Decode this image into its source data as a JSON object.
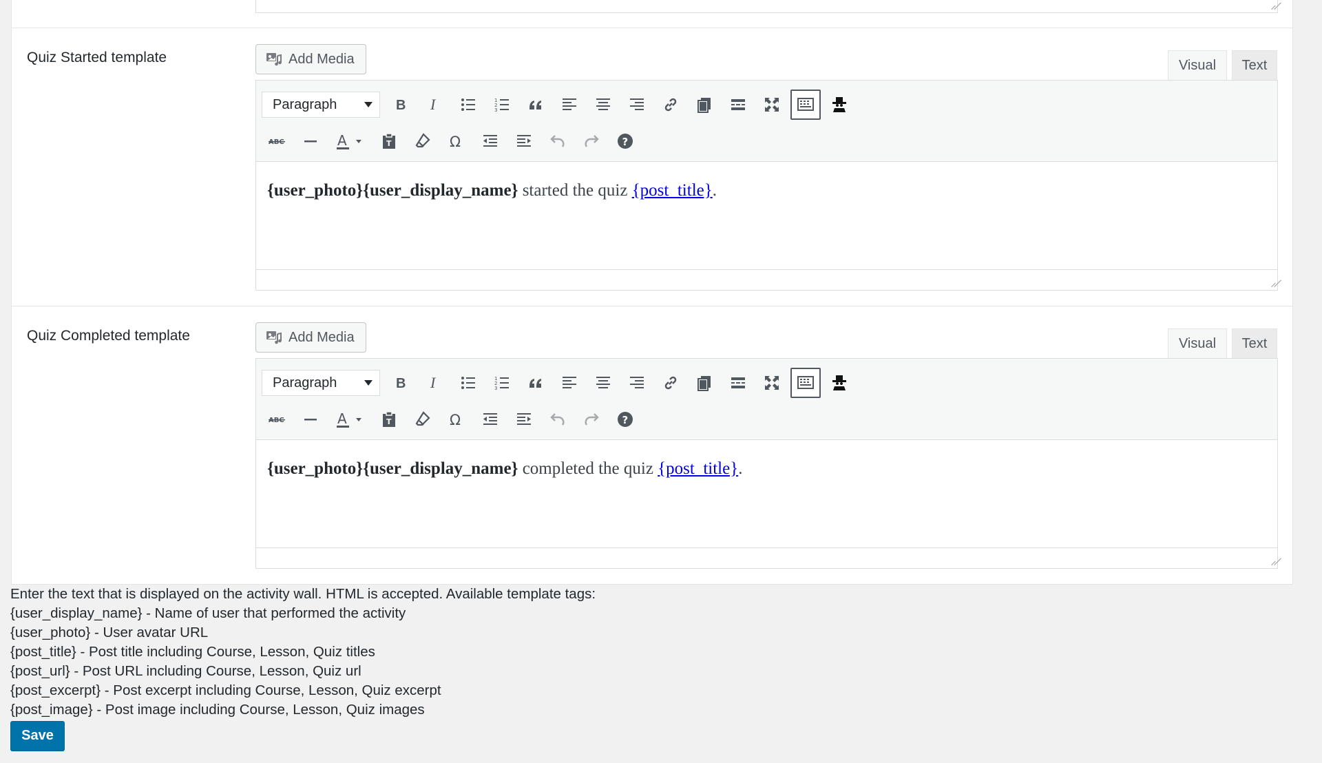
{
  "editors": [
    {
      "label": "Quiz Started template",
      "add_media": "Add Media",
      "tab_visual": "Visual",
      "tab_text": "Text",
      "format": "Paragraph",
      "content_tags": "{user_photo}{user_display_name}",
      "content_middle": " started the quiz ",
      "content_link": "{post_title}",
      "content_end": "."
    },
    {
      "label": "Quiz Completed template",
      "add_media": "Add Media",
      "tab_visual": "Visual",
      "tab_text": "Text",
      "format": "Paragraph",
      "content_tags": "{user_photo}{user_display_name}",
      "content_middle": " completed the quiz ",
      "content_link": "{post_title}",
      "content_end": "."
    }
  ],
  "toolbar_icons_row1": [
    "bold-icon",
    "italic-icon",
    "bullet-list-icon",
    "numbered-list-icon",
    "blockquote-icon",
    "align-left-icon",
    "align-center-icon",
    "align-right-icon",
    "link-icon",
    "insert-page-icon",
    "read-more-icon",
    "fullscreen-icon",
    "toolbar-toggle-icon",
    "spy-icon"
  ],
  "toolbar_icons_row2": [
    "strikethrough-icon",
    "horizontal-line-icon",
    "text-color-icon",
    "paste-text-icon",
    "clear-formatting-icon",
    "special-character-icon",
    "outdent-icon",
    "indent-icon",
    "undo-icon",
    "redo-icon",
    "help-icon"
  ],
  "help": {
    "intro": "Enter the text that is displayed on the activity wall. HTML is accepted. Available template tags:",
    "lines": [
      "{user_display_name} - Name of user that performed the activity",
      "{user_photo} - User avatar URL",
      "{post_title} - Post title including Course, Lesson, Quiz titles",
      "{post_url} - Post URL including Course, Lesson, Quiz url",
      "{post_excerpt} - Post excerpt including Course, Lesson, Quiz excerpt",
      "{post_image} - Post image including Course, Lesson, Quiz images"
    ]
  },
  "save_label": "Save",
  "colors": {
    "primary": "#0073aa",
    "link": "#0000ee",
    "toolbar_bg": "#f6f7f7"
  }
}
